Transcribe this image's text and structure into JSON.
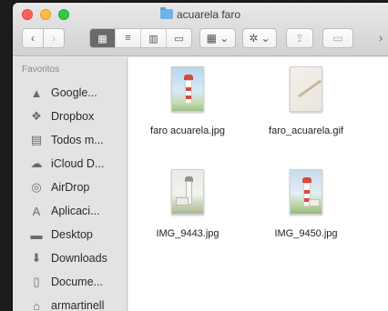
{
  "window": {
    "title": "acuarela faro"
  },
  "toolbar": {
    "back_label": "‹",
    "forward_label": "›",
    "view_icons": [
      "▦",
      "≡",
      "▥",
      "▭"
    ],
    "arrange_label": "▦ ⌄",
    "action_label": "✲ ⌄",
    "share_label": "⇪",
    "tags_label": "▭",
    "more_label": "›"
  },
  "sidebar": {
    "section_title": "Favoritos",
    "items": [
      {
        "label": "Google...",
        "icon": "google-drive-icon",
        "glyph": "▲"
      },
      {
        "label": "Dropbox",
        "icon": "dropbox-icon",
        "glyph": "❖"
      },
      {
        "label": "Todos m...",
        "icon": "all-files-icon",
        "glyph": "▤"
      },
      {
        "label": "iCloud D...",
        "icon": "cloud-icon",
        "glyph": "☁"
      },
      {
        "label": "AirDrop",
        "icon": "airdrop-icon",
        "glyph": "◎"
      },
      {
        "label": "Aplicaci...",
        "icon": "applications-icon",
        "glyph": "A"
      },
      {
        "label": "Desktop",
        "icon": "desktop-icon",
        "glyph": "▬"
      },
      {
        "label": "Downloads",
        "icon": "downloads-icon",
        "glyph": "⬇"
      },
      {
        "label": "Docume...",
        "icon": "documents-icon",
        "glyph": "▯"
      },
      {
        "label": "armartinell",
        "icon": "home-icon",
        "glyph": "⌂"
      }
    ]
  },
  "files": [
    {
      "name": "faro acuarela.jpg"
    },
    {
      "name": "faro_acuarela.gif"
    },
    {
      "name": "IMG_9443.jpg"
    },
    {
      "name": "IMG_9450.jpg"
    }
  ],
  "colors": {
    "close": "#fc605c",
    "minimize": "#fdbc40",
    "maximize": "#34c84a",
    "folder": "#6fb4e8"
  }
}
